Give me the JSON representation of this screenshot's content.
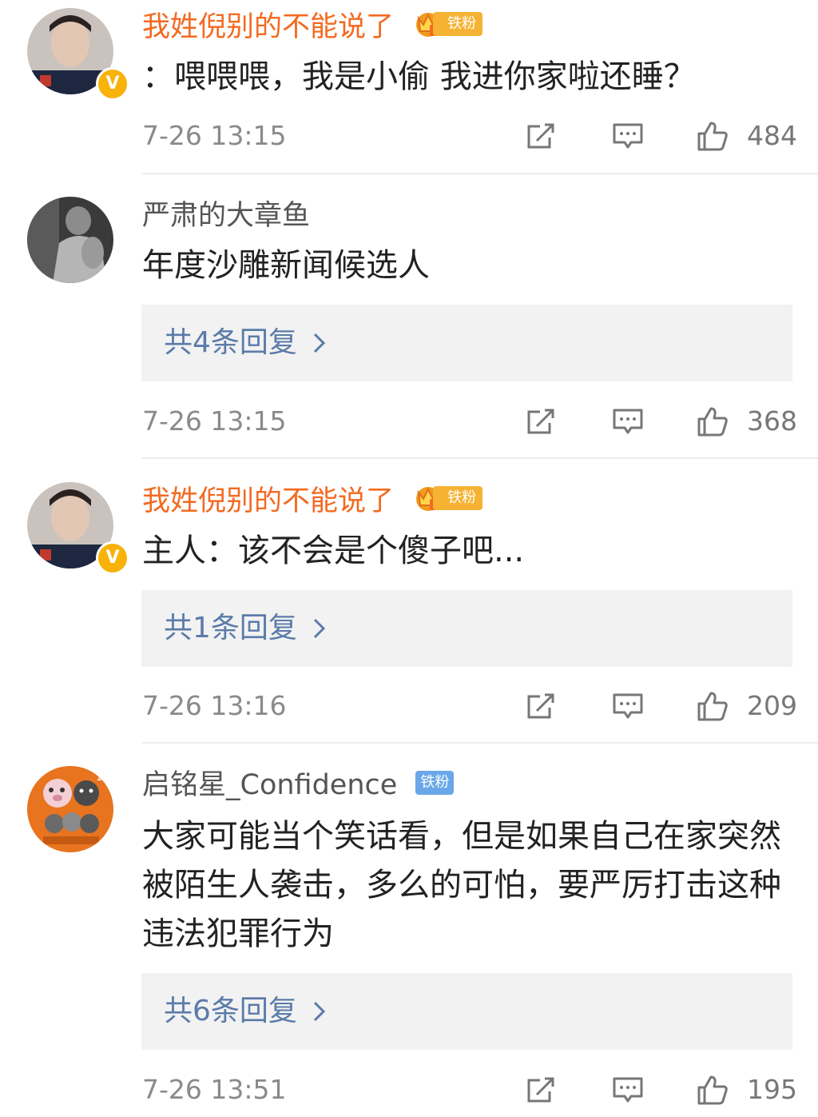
{
  "comments": [
    {
      "username": "我姓倪别的不能说了",
      "fan_badge": "铁粉",
      "text": "：喂喂喂，我是小偷 我进你家啦还睡？",
      "time": "7-26 13:15",
      "likes": "484"
    },
    {
      "username": "严肃的大章鱼",
      "text": "年度沙雕新闻候选人",
      "replies": "共4条回复",
      "time": "7-26 13:15",
      "likes": "368"
    },
    {
      "username": "我姓倪别的不能说了",
      "fan_badge": "铁粉",
      "text": "主人：该不会是个傻子吧...",
      "replies": "共1条回复",
      "time": "7-26 13:16",
      "likes": "209"
    },
    {
      "username": "启铭星_Confidence",
      "fan_badge": "铁粉",
      "text": "大家可能当个笑话看，但是如果自己在家突然被陌生人袭击，多么的可怕，要严厉打击这种违法犯罪行为",
      "replies": "共6条回复",
      "time": "7-26 13:51",
      "likes": "195"
    }
  ],
  "colors": {
    "vip_name": "#f36a21",
    "reply_link": "#5b7ba9",
    "fan_badge_gold": "#f6b333",
    "fan_badge_blue": "#6aa7e8",
    "verified": "#f8b20a"
  },
  "icons": {
    "share": "share-icon",
    "reply": "comment-icon",
    "like": "thumbs-up-icon",
    "verified": "verified-v-icon",
    "crown": "crown-icon",
    "chevron": "chevron-right-icon"
  },
  "verified_mark": "V",
  "avatar_number": "12"
}
